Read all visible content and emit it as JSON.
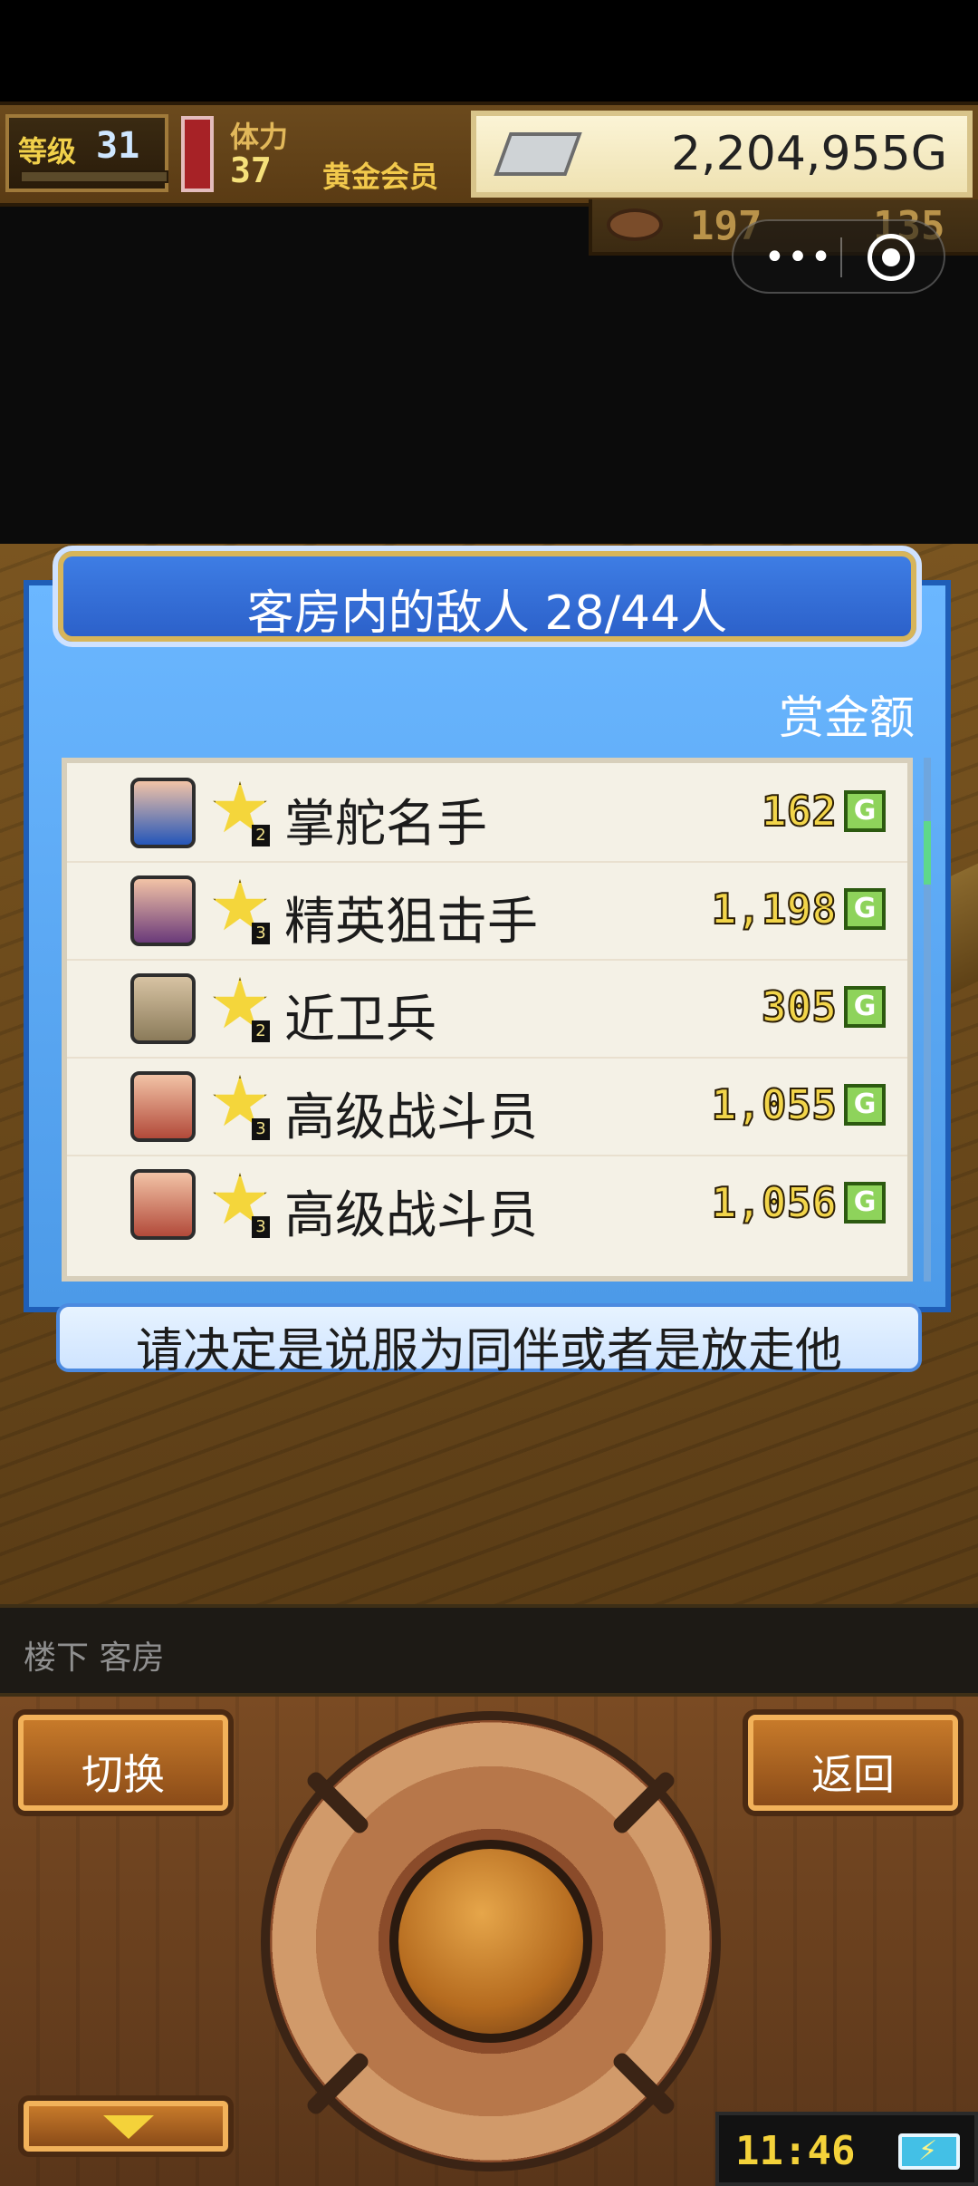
{
  "hud": {
    "level_label": "等级",
    "level": "31",
    "stamina_label": "体力",
    "stamina": "37",
    "membership": "黄金会员",
    "gold": "2,204,955G",
    "stat_1": "197",
    "stat_2": "135"
  },
  "mini_capsule": {
    "more_label": "•••"
  },
  "dialog": {
    "title": "客房内的敌人  28/44人",
    "bounty_header": "赏金额",
    "enemies": [
      {
        "name": "掌舵名手",
        "rank": "2",
        "bounty": "162",
        "currency": "G"
      },
      {
        "name": "精英狙击手",
        "rank": "3",
        "bounty": "1,198",
        "currency": "G"
      },
      {
        "name": "近卫兵",
        "rank": "2",
        "bounty": "305",
        "currency": "G"
      },
      {
        "name": "高级战斗员",
        "rank": "3",
        "bounty": "1,055",
        "currency": "G"
      },
      {
        "name": "高级战斗员",
        "rank": "3",
        "bounty": "1,056",
        "currency": "G"
      }
    ],
    "instruction": "请决定是说服为同伴或者是放走他"
  },
  "location": {
    "text": "楼下 客房"
  },
  "controls": {
    "switch_label": "切换",
    "back_label": "返回",
    "clock": "11:46"
  }
}
